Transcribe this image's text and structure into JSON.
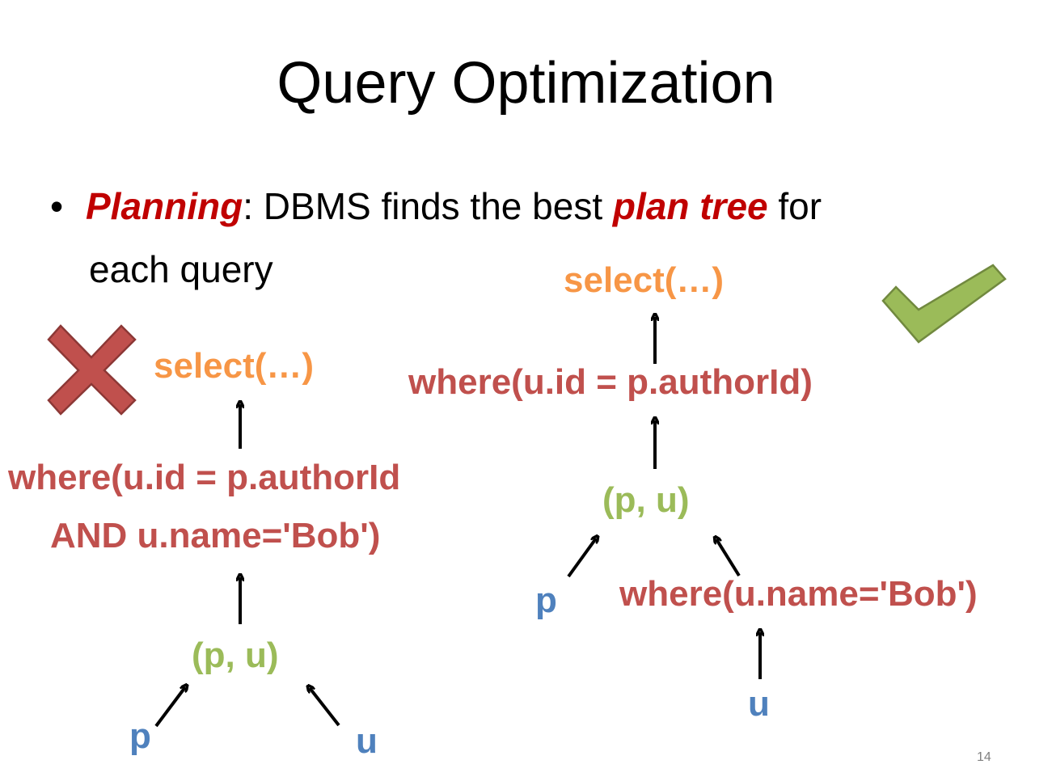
{
  "title": "Query Optimization",
  "bullet": {
    "term": "Planning",
    "text_a": ": DBMS finds the best ",
    "emph": "plan tree",
    "text_b": " for",
    "line2": "each query"
  },
  "left_tree": {
    "select": "select(…)",
    "where_line1": "where(u.id = p.authorId",
    "where_line2": "AND u.name='Bob')",
    "join": "(p, u)",
    "p": "p",
    "u": "u"
  },
  "right_tree": {
    "select": "select(…)",
    "where": "where(u.id = p.authorId)",
    "join": "(p, u)",
    "p": "p",
    "where_filter": "where(u.name='Bob')",
    "u": "u"
  },
  "colors": {
    "select": "#f79646",
    "where": "#c0504d",
    "join": "#9bbb59",
    "table": "#4f81bd",
    "emphasis": "#c00000",
    "cross": "#c0504d",
    "check": "#9bbb59"
  },
  "icons": {
    "left": "cross-icon",
    "right": "check-icon"
  },
  "page_number": "14"
}
